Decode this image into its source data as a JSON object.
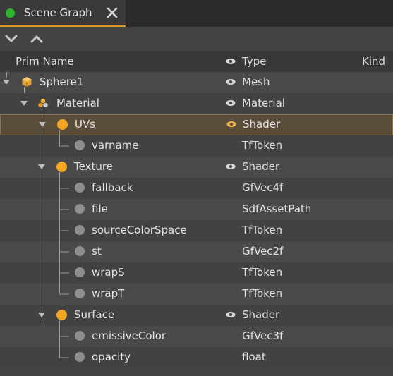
{
  "tab": {
    "title": "Scene Graph",
    "status_color": "#2db52d"
  },
  "toolbar": {
    "collapse_icon": "chevron-down-icon",
    "expand_icon": "chevron-up-icon"
  },
  "header": {
    "prim_name": "Prim Name",
    "type": "Type",
    "kind": "Kind"
  },
  "rows": [
    {
      "name": "Sphere1",
      "type": "Mesh",
      "icon": "mesh-cube-icon",
      "expanded": true,
      "visible_eye": true
    },
    {
      "name": "Material",
      "type": "Material",
      "icon": "material-icon",
      "expanded": true,
      "visible_eye": true
    },
    {
      "name": "UVs",
      "type": "Shader",
      "icon": "shader-icon",
      "expanded": true,
      "visible_eye": true,
      "selected": true
    },
    {
      "name": "varname",
      "type": "TfToken",
      "icon": "attribute-icon"
    },
    {
      "name": "Texture",
      "type": "Shader",
      "icon": "shader-icon",
      "expanded": true,
      "visible_eye": true
    },
    {
      "name": "fallback",
      "type": "GfVec4f",
      "icon": "attribute-icon"
    },
    {
      "name": "file",
      "type": "SdfAssetPath",
      "icon": "attribute-icon"
    },
    {
      "name": "sourceColorSpace",
      "type": "TfToken",
      "icon": "attribute-icon"
    },
    {
      "name": "st",
      "type": "GfVec2f",
      "icon": "attribute-icon"
    },
    {
      "name": "wrapS",
      "type": "TfToken",
      "icon": "attribute-icon"
    },
    {
      "name": "wrapT",
      "type": "TfToken",
      "icon": "attribute-icon"
    },
    {
      "name": "Surface",
      "type": "Shader",
      "icon": "shader-icon",
      "expanded": true,
      "visible_eye": true
    },
    {
      "name": "emissiveColor",
      "type": "GfVec3f",
      "icon": "attribute-icon"
    },
    {
      "name": "opacity",
      "type": "float",
      "icon": "attribute-icon"
    }
  ],
  "colors": {
    "accent": "#d89a20",
    "shader": "#f5a623",
    "selected_bg": "#5a4e3b"
  }
}
